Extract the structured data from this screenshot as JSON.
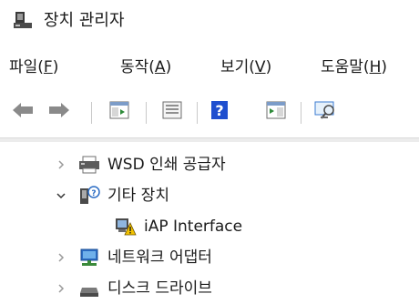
{
  "window": {
    "title": "장치 관리자"
  },
  "menu": [
    {
      "label": "파일",
      "accel": "F"
    },
    {
      "label": "동작",
      "accel": "A"
    },
    {
      "label": "보기",
      "accel": "V"
    },
    {
      "label": "도움말",
      "accel": "H"
    }
  ],
  "toolbar": {
    "buttons": [
      "back-arrow-icon",
      "forward-arrow-icon",
      "properties-icon",
      "console-tree-icon",
      "help-icon",
      "action-pane-icon",
      "monitor-icon"
    ]
  },
  "tree": [
    {
      "label": "WSD 인쇄 공급자",
      "expanded": false,
      "icon": "printer-icon",
      "level": 0
    },
    {
      "label": "기타 장치",
      "expanded": true,
      "icon": "unknown-device-icon",
      "level": 0
    },
    {
      "label": "iAP Interface",
      "expanded": null,
      "icon": "warning-device-icon",
      "level": 1
    },
    {
      "label": "네트워크 어댑터",
      "expanded": false,
      "icon": "network-adapter-icon",
      "level": 0
    },
    {
      "label": "디스크 드라이브",
      "expanded": false,
      "icon": "disk-drive-icon",
      "level": 0
    }
  ],
  "colors": {
    "accent_blue": "#2b6cc4",
    "warning_yellow": "#f2c200",
    "help_blue": "#1f4fcf"
  }
}
